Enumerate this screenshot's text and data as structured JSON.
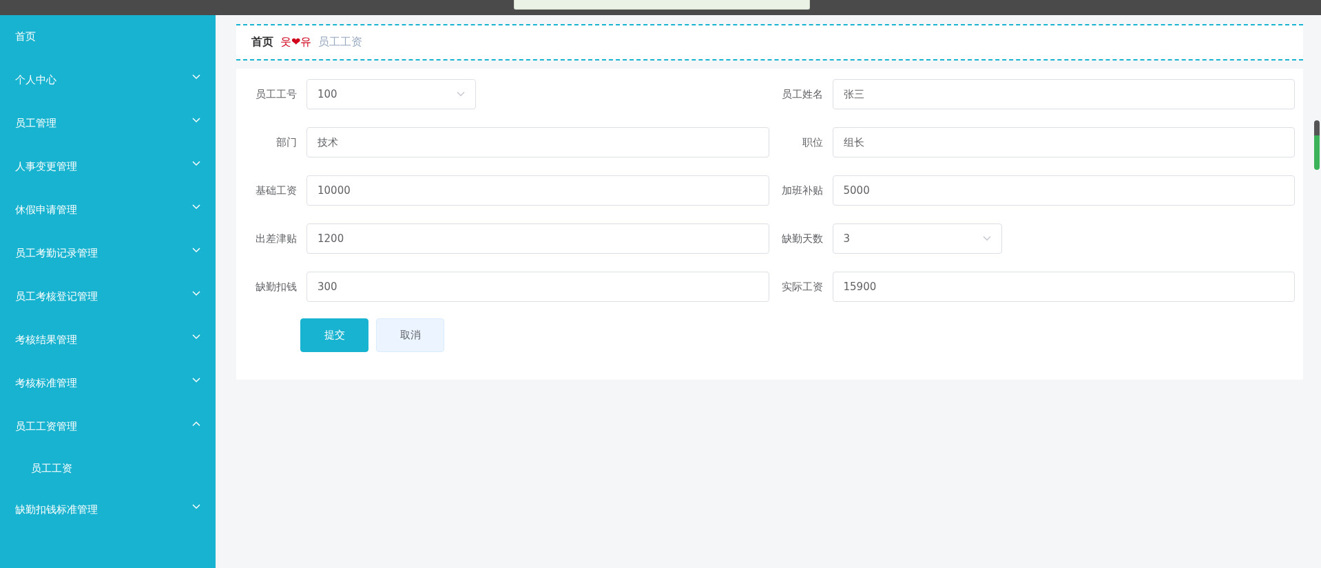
{
  "sidebar": {
    "items": [
      {
        "label": "首页",
        "kind": "link"
      },
      {
        "label": "个人中心",
        "kind": "submenu",
        "expanded": false
      },
      {
        "label": "员工管理",
        "kind": "submenu",
        "expanded": false
      },
      {
        "label": "人事变更管理",
        "kind": "submenu",
        "expanded": false
      },
      {
        "label": "休假申请管理",
        "kind": "submenu",
        "expanded": false
      },
      {
        "label": "员工考勤记录管理",
        "kind": "submenu",
        "expanded": false
      },
      {
        "label": "员工考核登记管理",
        "kind": "submenu",
        "expanded": false
      },
      {
        "label": "考核结果管理",
        "kind": "submenu",
        "expanded": false
      },
      {
        "label": "考核标准管理",
        "kind": "submenu",
        "expanded": false
      },
      {
        "label": "员工工资管理",
        "kind": "submenu",
        "expanded": true,
        "children": [
          {
            "label": "员工工资"
          }
        ]
      },
      {
        "label": "缺勤扣钱标准管理",
        "kind": "submenu",
        "expanded": false
      }
    ]
  },
  "breadcrumb": {
    "items": [
      "首页",
      "员工工资"
    ],
    "separator": "웃❤유"
  },
  "form": {
    "fields": [
      {
        "label": "员工工号",
        "value": "100",
        "kind": "select"
      },
      {
        "label": "员工姓名",
        "value": "张三",
        "kind": "input"
      },
      {
        "label": "部门",
        "value": "技术",
        "kind": "input"
      },
      {
        "label": "职位",
        "value": "组长",
        "kind": "input"
      },
      {
        "label": "基础工资",
        "value": "10000",
        "kind": "input"
      },
      {
        "label": "加班补贴",
        "value": "5000",
        "kind": "input"
      },
      {
        "label": "出差津贴",
        "value": "1200",
        "kind": "input"
      },
      {
        "label": "缺勤天数",
        "value": "3",
        "kind": "select"
      },
      {
        "label": "缺勤扣钱",
        "value": "300",
        "kind": "input"
      },
      {
        "label": "实际工资",
        "value": "15900",
        "kind": "input"
      }
    ],
    "buttons": [
      {
        "label": "提交",
        "kind": "primary"
      },
      {
        "label": "取消",
        "kind": "secondary"
      }
    ]
  }
}
